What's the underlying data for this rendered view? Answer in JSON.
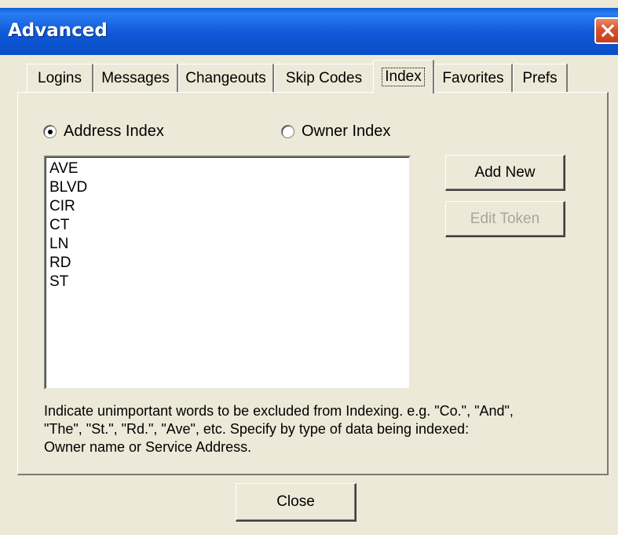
{
  "window": {
    "title": "Advanced",
    "close_icon": "close-x-icon"
  },
  "tabs": [
    {
      "label": "Logins",
      "active": false
    },
    {
      "label": "Messages",
      "active": false
    },
    {
      "label": "Changeouts",
      "active": false
    },
    {
      "label": "Skip Codes",
      "active": false
    },
    {
      "label": "Index",
      "active": true
    },
    {
      "label": "Favorites",
      "active": false
    },
    {
      "label": "Prefs",
      "active": false
    }
  ],
  "index_panel": {
    "radio_address": {
      "label": "Address Index",
      "selected": true
    },
    "radio_owner": {
      "label": "Owner Index",
      "selected": false
    },
    "tokens": [
      "AVE",
      "BLVD",
      "CIR",
      "CT",
      "LN",
      "RD",
      "ST"
    ],
    "add_new_label": "Add New",
    "edit_token_label": "Edit Token",
    "edit_token_enabled": false,
    "note": "Indicate unimportant words to be excluded from Indexing.  e.g. \"Co.\", \"And\",\n\"The\", \"St.\", \"Rd.\", \"Ave\", etc.  Specify by type of data being indexed:\nOwner name or Service Address."
  },
  "footer": {
    "close_label": "Close"
  },
  "colors": {
    "titlebar": "#0a5ed8",
    "face": "#ece9d8",
    "close_button": "#d9522b",
    "disabled_text": "#a9a69a"
  }
}
